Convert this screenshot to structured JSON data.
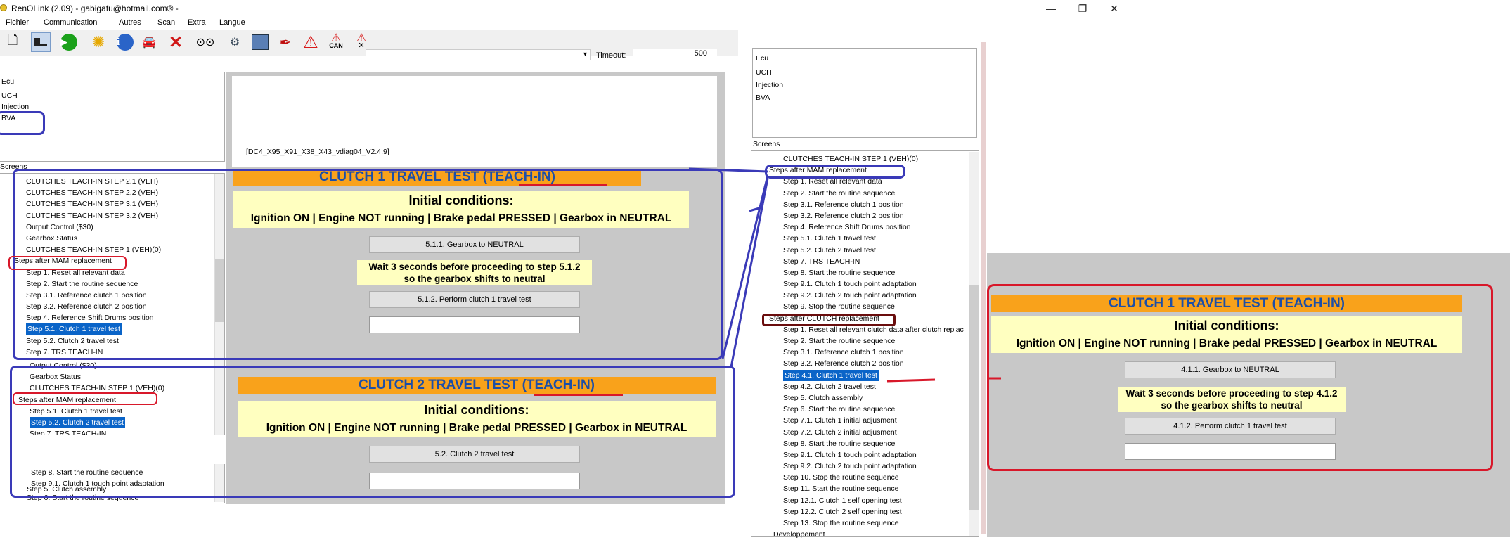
{
  "window": {
    "title": "RenOLink (2.09) - gabigafu@hotmail.com® -",
    "min": "—",
    "max": "❐",
    "close": "✕"
  },
  "menu": [
    "Fichier",
    "Communication",
    "Autres",
    "Scan",
    "Extra",
    "Langue"
  ],
  "toolbar": {
    "icons": [
      "new-doc-icon",
      "graph-icon",
      "play-icon",
      "gear-icon",
      "info-icon",
      "car-icon",
      "stop-icon",
      "binoculars-icon",
      "usb-icon",
      "calculator-icon",
      "pen-icon",
      "warning-icon",
      "warning-can-icon",
      "warning-clear-icon"
    ],
    "can_label": "CAN",
    "timeout_label": "Timeout:",
    "timeout_value": "500"
  },
  "ecu_list": [
    "Ecu",
    "UCH",
    "Injection",
    "BVA"
  ],
  "screens_label": "Screens",
  "file_label": "[DC4_X95_X91_X38_X43_vdiag04_V2.4.9]",
  "left_tree_a": [
    "CLUTCHES TEACH-IN STEP 2.1 (VEH)",
    "CLUTCHES TEACH-IN STEP 2.2 (VEH)",
    "CLUTCHES TEACH-IN STEP 3.1 (VEH)",
    "CLUTCHES TEACH-IN STEP 3.2 (VEH)",
    "Output Control ($30)",
    "Gearbox Status",
    "CLUTCHES TEACH-IN STEP 1 (VEH)(0)",
    "Steps after MAM replacement",
    "Step 1. Reset all relevant data",
    "Step 2. Start the routine sequence",
    "Step 3.1. Reference clutch 1 position",
    "Step 3.2. Reference clutch 2 position",
    "Step 4. Reference Shift Drums position",
    "Step 5.1. Clutch 1 travel test",
    "Step 5.2. Clutch 2 travel test",
    "Step 7. TRS TEACH-IN"
  ],
  "left_tree_b": [
    "Output Control ($30)",
    "Gearbox Status",
    "CLUTCHES TEACH-IN STEP 1 (VEH)(0)",
    "Steps after MAM replacement",
    "Step 5.1. Clutch 1 travel test",
    "Step 5.2. Clutch 2 travel test",
    "Step 7. TRS TEACH-IN",
    "Step 8. Start the routine sequence",
    "Step 9.1. Clutch 1 touch point adaptation",
    "Step 5. Clutch assembly",
    "Step 6. Start the routine sequence"
  ],
  "clutch1": {
    "title": "CLUTCH 1 TRAVEL TEST (TEACH-IN)",
    "initial": "Initial conditions:",
    "conditions": "Ignition ON | Engine NOT running | Brake pedal PRESSED | Gearbox in NEUTRAL",
    "btn1": "5.1.1. Gearbox to NEUTRAL",
    "wait": "Wait 3 seconds before proceeding to step 5.1.2 so the gearbox shifts to neutral",
    "btn2": "5.1.2. Perform clutch 1 travel test"
  },
  "clutch2": {
    "title": "CLUTCH 2 TRAVEL TEST (TEACH-IN)",
    "initial": "Initial conditions:",
    "conditions": "Ignition ON | Engine NOT running | Brake pedal PRESSED | Gearbox in NEUTRAL",
    "btn1": "5.2. Clutch 2 travel test"
  },
  "right_tree": [
    "CLUTCHES TEACH-IN STEP 1 (VEH)(0)",
    "Steps after MAM replacement",
    "Step 1. Reset all relevant data",
    "Step 2. Start the routine sequence",
    "Step 3.1. Reference clutch 1 position",
    "Step 3.2. Reference clutch 2 position",
    "Step 4. Reference Shift Drums position",
    "Step 5.1. Clutch 1 travel test",
    "Step 5.2. Clutch 2 travel test",
    "Step 7. TRS TEACH-IN",
    "Step 8. Start the routine sequence",
    "Step 9.1. Clutch 1 touch point adaptation",
    "Step 9.2. Clutch 2 touch point adaptation",
    "Step 9. Stop the routine sequence",
    "Steps after CLUTCH replacement",
    "Step 1. Reset all relevant clutch data after clutch replac",
    "Step 2. Start the routine sequence",
    "Step 3.1. Reference clutch 1 position",
    "Step 3.2. Reference clutch 2 position",
    "Step 4.1. Clutch 1 travel test",
    "Step 4.2. Clutch 2 travel test",
    "Step 5. Clutch assembly",
    "Step 6. Start the routine sequence",
    "Step 7.1. Clutch 1 initial adjusment",
    "Step 7.2. Clutch 2 initial adjusment",
    "Step 8. Start the routine sequence",
    "Step 9.1. Clutch 1 touch point adaptation",
    "Step 9.2. Clutch 2 touch point adaptation",
    "Step 10. Stop the routine sequence",
    "Step 11. Start the routine sequence",
    "Step 12.1. Clutch 1 self opening test",
    "Step 12.2. Clutch 2 self opening test",
    "Step 13. Stop the routine sequence",
    "Developpement"
  ],
  "clutch1b": {
    "title": "CLUTCH 1 TRAVEL TEST (TEACH-IN)",
    "initial": "Initial conditions:",
    "conditions": "Ignition ON | Engine NOT running | Brake pedal PRESSED | Gearbox in NEUTRAL",
    "btn1": "4.1.1. Gearbox to NEUTRAL",
    "wait": "Wait 3 seconds before proceeding to step 4.1.2 so the gearbox shifts to neutral",
    "btn2": "4.1.2. Perform clutch 1 travel test"
  }
}
